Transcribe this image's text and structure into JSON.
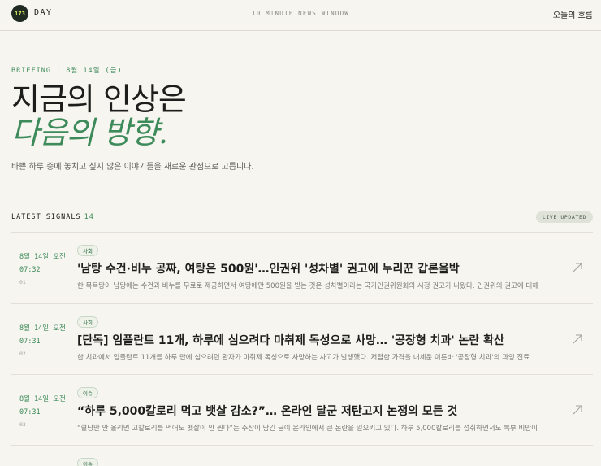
{
  "header": {
    "logo_badge": "173",
    "logo_text": "DAY",
    "window_label": "10 MINUTE NEWS WINDOW",
    "flow_link": "오늘의 흐름"
  },
  "hero": {
    "eyebrow": "BRIEFING · 8월 14일 (금)",
    "line1": "지금의 인상은",
    "line2": "다음의 방향.",
    "subtitle": "바쁜 하루 중에 놓치고 싶지 않은 이야기들을 새로운 관점으로 고릅니다."
  },
  "signals": {
    "label": "LATEST SIGNALS",
    "count": "14",
    "live_badge": "LIVE UPDATED"
  },
  "items": [
    {
      "date": "8월 14일 오전",
      "time": "07:32",
      "num": "01",
      "tag": "사회",
      "title": "'남탕 수건·비누 공짜, 여탕은 500원'…인권위 '성차별' 권고에 누리꾼 갑론을박",
      "summary": "한 목욕탕이 남탕에는 수건과 비누를 무료로 제공하면서 여탕에만 500원을 받는 것은 성차별이라는 국가인권위원회의 시정 권고가 나왔다. 인권위의 권고에 대해"
    },
    {
      "date": "8월 14일 오전",
      "time": "07:31",
      "num": "02",
      "tag": "사회",
      "title": "[단독] 임플란트 11개, 하루에 심으려다 마취제 독성으로 사망… '공장형 치과' 논란 확산",
      "summary": "한 치과에서 임플란트 11개를 하루 만에 심으려던 환자가 마취제 독성으로 사망하는 사고가 발생했다. 저렴한 가격을 내세운 이른바 '공장형 치과'의 과잉 진료"
    },
    {
      "date": "8월 14일 오전",
      "time": "07:31",
      "num": "03",
      "tag": "이슈",
      "title": "“하루 5,000칼로리 먹고 뱃살 감소?”… 온라인 달군 저탄고지 논쟁의 모든 것",
      "summary": "“혈당만 안 올리면 고칼로리를 먹어도 뱃살이 안 찐다”는 주장이 담긴 글이 온라인에서 큰 논란을 일으키고 있다. 하루 5,000칼로리를 섭취하면서도 복부 비만이"
    },
    {
      "tag": "이슈"
    }
  ]
}
